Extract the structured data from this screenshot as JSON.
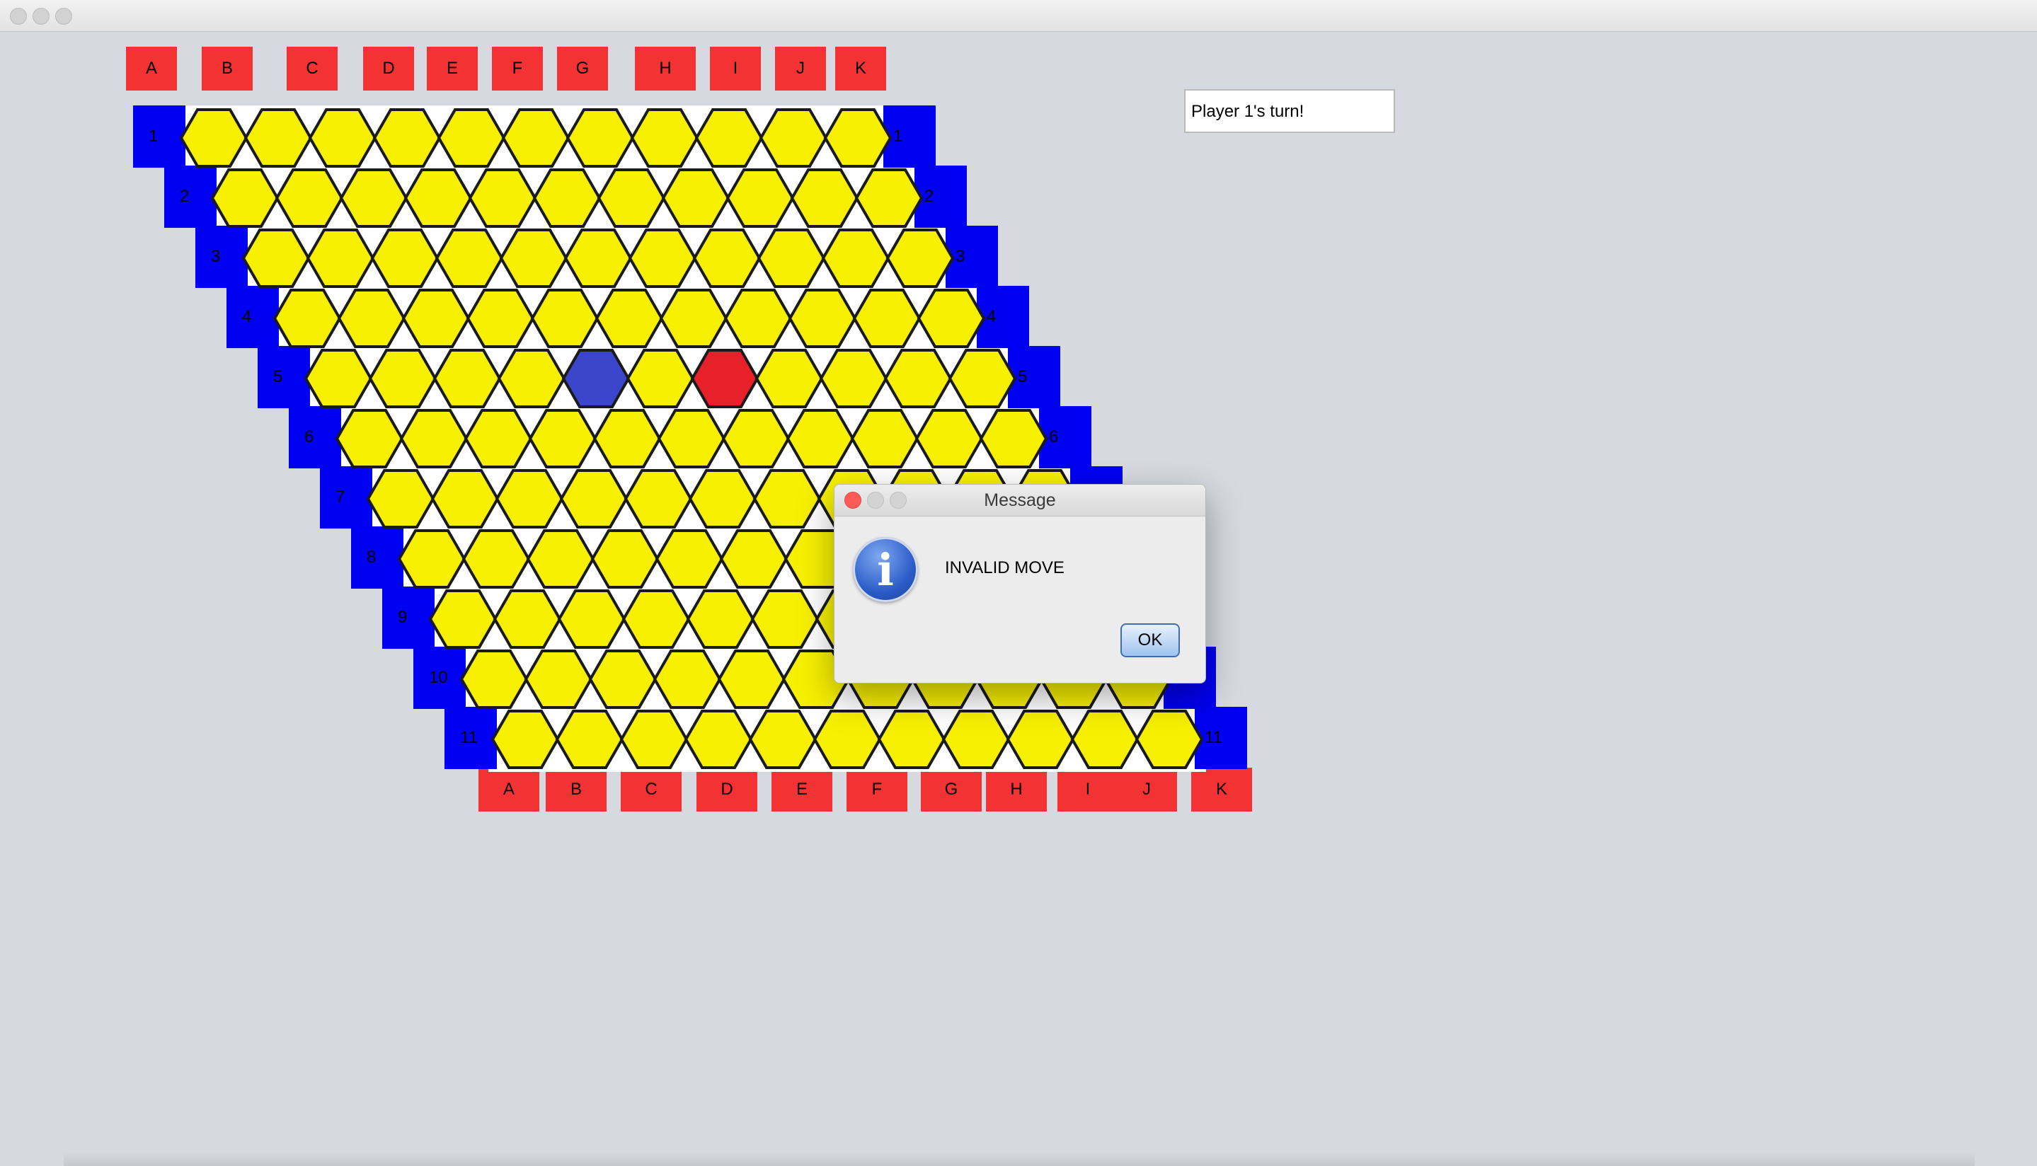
{
  "window": {
    "title": ""
  },
  "status": {
    "text": "Player 1's turn!"
  },
  "board": {
    "size": 11,
    "columns_top": [
      "A",
      "B",
      "C",
      "D",
      "E",
      "F",
      "G",
      "H",
      "I",
      "J",
      "K"
    ],
    "columns_bottom": [
      "A",
      "B",
      "C",
      "D",
      "E",
      "F",
      "G",
      "H",
      "I",
      "J",
      "K"
    ],
    "rows": [
      "1",
      "2",
      "3",
      "4",
      "5",
      "6",
      "7",
      "8",
      "9",
      "10",
      "11"
    ],
    "cell_color": "#f7f000",
    "label_red": "#f33333",
    "label_blue": "#0000f2",
    "stones": [
      {
        "row": 5,
        "col": "E",
        "color": "#3a45cc",
        "player": "blue"
      },
      {
        "row": 5,
        "col": "G",
        "color": "#e8202a",
        "player": "red"
      }
    ]
  },
  "dialog": {
    "title": "Message",
    "message": "INVALID MOVE",
    "icon": "info-icon",
    "ok_label": "OK"
  }
}
